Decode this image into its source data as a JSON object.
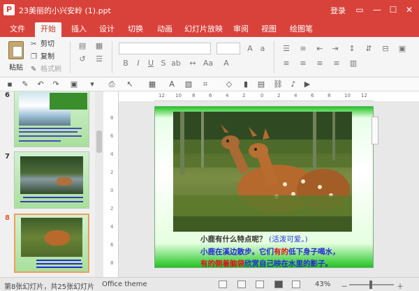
{
  "title_bar": {
    "app_icon": "P",
    "doc_title": "23美丽的小兴安岭 (1).ppt",
    "login": "登录",
    "restore_icon": "restore-icon",
    "minimize_glyph": "—",
    "maximize_glyph": "☐",
    "close_glyph": "✕"
  },
  "tabs": [
    "文件",
    "开始",
    "插入",
    "设计",
    "切换",
    "动画",
    "幻灯片放映",
    "审阅",
    "视图",
    "绘图笔"
  ],
  "active_tab": "开始",
  "ribbon": {
    "paste": "粘贴",
    "cut": "剪切",
    "copy": "复制",
    "format_painter": "格式刷"
  },
  "thumbnails": [
    {
      "num": "6",
      "selected": false
    },
    {
      "num": "7",
      "selected": false
    },
    {
      "num": "8",
      "selected": true
    }
  ],
  "slide": {
    "q1_text": "小鹿有什么特点呢？",
    "q1_answer": "(活泼可爱。)",
    "line2_a": "小鹿在溪边散步。它们",
    "line2_red": "有的",
    "line2_b": "低下身子喝水，",
    "line3_red1": "有的",
    "line3_red2": "侧着脑袋",
    "line3_b": "欣赏自己映在水里的影子。"
  },
  "rulers": {
    "h_ticks": [
      "12",
      "10",
      "8",
      "6",
      "4",
      "2",
      "0",
      "2",
      "4",
      "6",
      "8",
      "10",
      "12"
    ],
    "v_ticks": [
      "8",
      "6",
      "4",
      "2",
      "0",
      "2",
      "4",
      "6",
      "8"
    ]
  },
  "status": {
    "slide_info": "第8张幻灯片，共25张幻灯片",
    "theme": "Office theme",
    "zoom": "43%",
    "zoom_minus": "－",
    "zoom_plus": "＋"
  },
  "colors": {
    "accent": "#d9423b",
    "slide_text_blue": "#2828d8",
    "slide_text_red": "#e01020"
  }
}
